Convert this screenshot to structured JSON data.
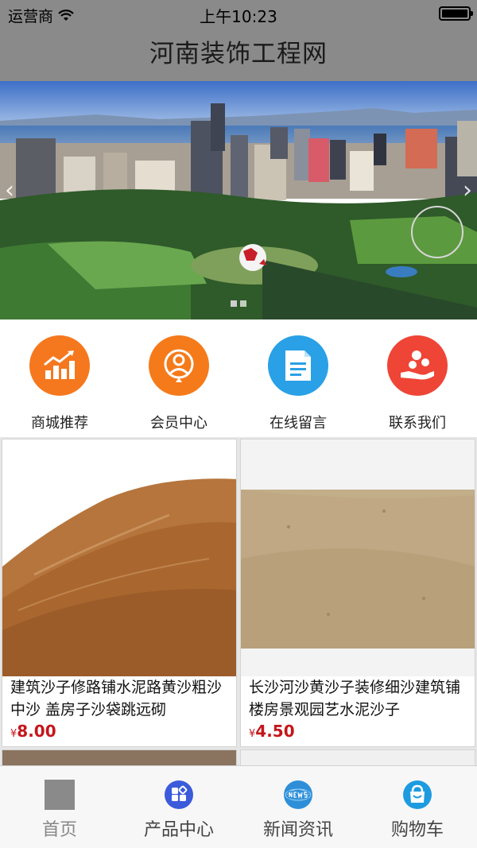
{
  "status_bar": {
    "carrier": "运营商",
    "time": "上午10:23"
  },
  "title": "河南装饰工程网",
  "banner": {
    "arrow_left": "‹",
    "arrow_right": "›",
    "slides": 2,
    "active_slide": 1
  },
  "quick_nav": [
    {
      "label": "商城推荐",
      "icon": "chart-icon",
      "color": "#f5781e"
    },
    {
      "label": "会员中心",
      "icon": "user-icon",
      "color": "#f57a1a"
    },
    {
      "label": "在线留言",
      "icon": "message-icon",
      "color": "#2aa0e6"
    },
    {
      "label": "联系我们",
      "icon": "contact-hand-icon",
      "color": "#ee4536"
    }
  ],
  "products": [
    {
      "name": "建筑沙子修路铺水泥路黄沙粗沙 中沙 盖房子沙袋跳远砌",
      "currency": "¥",
      "price": "8.00"
    },
    {
      "name": "长沙河沙黄沙子装修细沙建筑铺楼房景观园艺水泥沙子",
      "currency": "¥",
      "price": "4.50"
    }
  ],
  "tab_bar": [
    {
      "label": "首页",
      "icon": "home-placeholder-icon",
      "active": true
    },
    {
      "label": "产品中心",
      "icon": "product-icon",
      "color": "#3b5bdb"
    },
    {
      "label": "新闻资讯",
      "icon": "news-icon",
      "color": "#2e8fd8"
    },
    {
      "label": "购物车",
      "icon": "cart-icon",
      "color": "#1d9be0"
    }
  ]
}
